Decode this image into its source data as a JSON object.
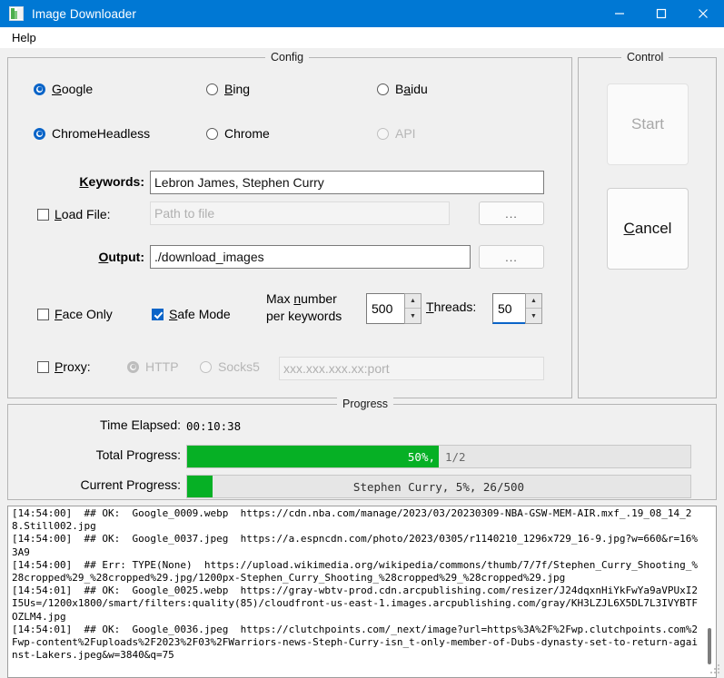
{
  "window": {
    "title": "Image Downloader",
    "icon": "image-icon",
    "minimize_label": "minimize-icon",
    "maximize_label": "maximize-icon",
    "close_label": "close-icon"
  },
  "menubar": {
    "items": [
      {
        "label": "Help"
      }
    ]
  },
  "config": {
    "title": "Config",
    "engines": [
      {
        "label": "Google",
        "mnemonic": "G",
        "rest": "oogle",
        "selected": true,
        "disabled": false
      },
      {
        "label": "Bing",
        "mnemonic": "B",
        "rest": "ing",
        "selected": false,
        "disabled": false
      },
      {
        "label": "Baidu",
        "pre": "B",
        "mnemonic": "a",
        "rest": "idu",
        "selected": false,
        "disabled": false
      }
    ],
    "drivers": [
      {
        "label": "ChromeHeadless",
        "selected": true,
        "disabled": false
      },
      {
        "label": "Chrome",
        "selected": false,
        "disabled": false
      },
      {
        "label": "API",
        "selected": false,
        "disabled": true
      }
    ],
    "keywords": {
      "label": "Keywords:",
      "mnemonic": "K",
      "rest": "eywords:",
      "value": "Lebron James, Stephen Curry"
    },
    "load_file": {
      "label": "Load File:",
      "mnemonic": "L",
      "rest": "oad File:",
      "checked": false,
      "placeholder": "Path to file",
      "value": "",
      "browse_label": "..."
    },
    "output": {
      "label": "Output:",
      "mnemonic": "O",
      "rest": "utput:",
      "value": "./download_images",
      "browse_label": "..."
    },
    "face_only": {
      "label": "Face Only",
      "mnemonic": "F",
      "rest": "ace Only",
      "checked": false
    },
    "safe_mode": {
      "label": "Safe Mode",
      "mnemonic": "S",
      "rest": "afe Mode",
      "checked": true
    },
    "max_number": {
      "label_line1_pre": "Max ",
      "label_line1_mnemonic": "n",
      "label_line1_rest": "umber",
      "label_line2": "per keywords",
      "value": "500"
    },
    "threads": {
      "mnemonic": "T",
      "rest": "hreads:",
      "value": "50",
      "focused": true
    },
    "proxy": {
      "label": "Proxy:",
      "mnemonic": "P",
      "rest": "roxy:",
      "checked": false,
      "types": [
        {
          "label": "HTTP",
          "selected": true,
          "disabled": true
        },
        {
          "label": "Socks5",
          "selected": false,
          "disabled": true
        }
      ],
      "placeholder": "xxx.xxx.xxx.xx:port",
      "value": ""
    }
  },
  "control": {
    "title": "Control",
    "start": {
      "label": "Start",
      "disabled": true
    },
    "cancel": {
      "label": "Cancel",
      "mnemonic": "C",
      "rest": "ancel",
      "disabled": false
    }
  },
  "progress": {
    "title": "Progress",
    "time_elapsed": {
      "label": "Time Elapsed:",
      "value": "00:10:38"
    },
    "total": {
      "label": "Total Progress:",
      "percent": 50,
      "fill_text": "50%,",
      "trailing_text": "1/2",
      "bar_color": "#06b025"
    },
    "current": {
      "label": "Current Progress:",
      "percent": 5,
      "text": "Stephen Curry,  5%,  26/500",
      "bar_color": "#06b025"
    }
  },
  "log": {
    "lines": [
      "[14:54:00]  ## OK:  Google_0009.webp  https://cdn.nba.com/manage/2023/03/20230309-NBA-GSW-MEM-AIR.mxf_.19_08_14_28.Still002.jpg",
      "[14:54:00]  ## OK:  Google_0037.jpeg  https://a.espncdn.com/photo/2023/0305/r1140210_1296x729_16-9.jpg?w=660&r=16%3A9",
      "[14:54:00]  ## Err: TYPE(None)  https://upload.wikimedia.org/wikipedia/commons/thumb/7/7f/Stephen_Curry_Shooting_%28cropped%29_%28cropped%29.jpg/1200px-Stephen_Curry_Shooting_%28cropped%29_%28cropped%29.jpg",
      "[14:54:01]  ## OK:  Google_0025.webp  https://gray-wbtv-prod.cdn.arcpublishing.com/resizer/J24dqxnHiYkFwYa9aVPUxI2I5Us=/1200x1800/smart/filters:quality(85)/cloudfront-us-east-1.images.arcpublishing.com/gray/KH3LZJL6X5DL7L3IVYBTFOZLM4.jpg",
      "[14:54:01]  ## OK:  Google_0036.jpeg  https://clutchpoints.com/_next/image?url=https%3A%2F%2Fwp.clutchpoints.com%2Fwp-content%2Fuploads%2F2023%2F03%2FWarriors-news-Steph-Curry-isn_t-only-member-of-Dubs-dynasty-set-to-return-against-Lakers.jpeg&w=3840&q=75"
    ]
  }
}
